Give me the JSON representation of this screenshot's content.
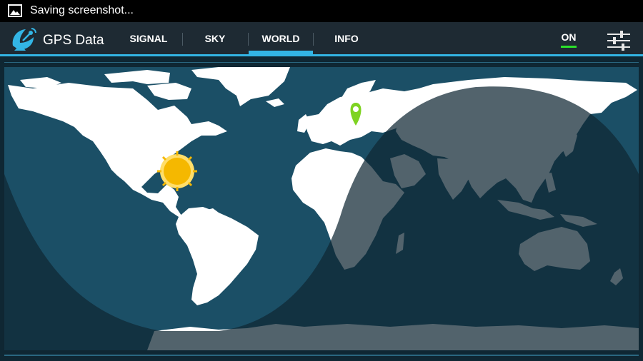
{
  "status_bar": {
    "text": "Saving screenshot..."
  },
  "app": {
    "title": "GPS Data"
  },
  "tabs": [
    {
      "label": "SIGNAL",
      "selected": false
    },
    {
      "label": "SKY",
      "selected": false
    },
    {
      "label": "WORLD",
      "selected": true
    },
    {
      "label": "INFO",
      "selected": false
    }
  ],
  "gps_toggle": {
    "label": "ON",
    "color": "#2be02b"
  },
  "colors": {
    "accent": "#33b5e5",
    "ocean_day": "#1b4f66",
    "land_day": "#ffffff",
    "night_overlay": "#0f2733",
    "pin": "#7ed321",
    "sun": "#f5b800"
  },
  "icons": {
    "status": "image-icon",
    "logo": "satellite-dish-icon",
    "settings": "sliders-icon",
    "sun": "sun-icon",
    "pin": "location-pin-icon"
  }
}
